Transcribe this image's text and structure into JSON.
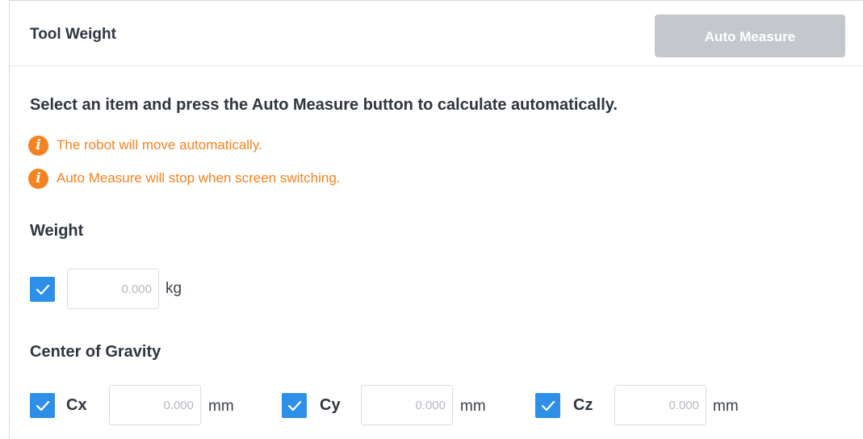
{
  "panel": {
    "title": "Tool Weight",
    "auto_measure_label": "Auto Measure",
    "description": "Select an item and press the Auto Measure button to calculate automatically.",
    "notices": [
      {
        "icon": "info-icon",
        "text": "The robot will move automatically."
      },
      {
        "icon": "info-icon",
        "text": "Auto Measure will stop when screen switching."
      }
    ],
    "accent_color": "#2e8fe8",
    "warning_color": "#f58220"
  },
  "weight": {
    "title": "Weight",
    "checked": true,
    "value": "0.000",
    "unit": "kg"
  },
  "center_of_gravity": {
    "title": "Center of Gravity",
    "axes": [
      {
        "label": "Cx",
        "checked": true,
        "value": "0.000",
        "unit": "mm"
      },
      {
        "label": "Cy",
        "checked": true,
        "value": "0.000",
        "unit": "mm"
      },
      {
        "label": "Cz",
        "checked": true,
        "value": "0.000",
        "unit": "mm"
      }
    ]
  }
}
